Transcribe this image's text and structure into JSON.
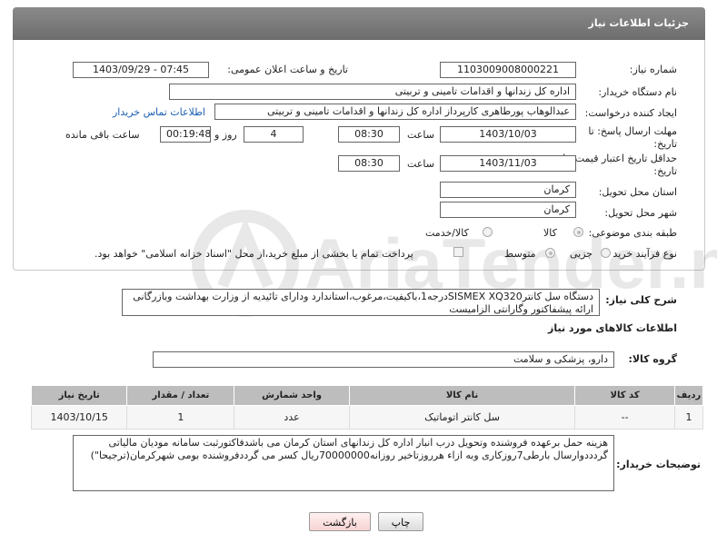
{
  "header": {
    "title": "جزئیات اطلاعات نیاز"
  },
  "form": {
    "need_number_label": "شماره نیاز:",
    "need_number": "1103009008000221",
    "announce_label": "تاریخ و ساعت اعلان عمومی:",
    "announce_value": "1403/09/29 - 07:45",
    "buyer_label": "نام دستگاه خریدار:",
    "buyer_value": "اداره کل زندانها و اقدامات تامینی و تربیتی",
    "creator_label": "ایجاد کننده درخواست:",
    "creator_value": "عبدالوهاب پورطاهری کارپرداز اداره کل زندانها و اقدامات تامینی و تربیتی",
    "contact_link": "اطلاعات تماس خریدار",
    "deadline_label_line1": "مهلت ارسال پاسخ: تا",
    "deadline_label_line2": "تاریخ:",
    "deadline_date": "1403/10/03",
    "time_label": "ساعت",
    "deadline_time": "08:30",
    "days_value": "4",
    "day_and_label": "روز و",
    "remaining_time": "00:19:48",
    "remaining_label": "ساعت باقی مانده",
    "validity_label_line1": "حداقل تاریخ اعتبار قیمت: تا",
    "validity_label_line2": "تاریخ:",
    "validity_date": "1403/11/03",
    "validity_time": "08:30",
    "province_label": "استان محل تحویل:",
    "province_value": "کرمان",
    "city_label": "شهر محل تحویل:",
    "city_value": "کرمان",
    "category_label": "طبقه بندی موضوعی:",
    "category_goods": "کالا",
    "category_goods_service": "کالا/خدمت",
    "purchase_type_label": "نوع فرآیند خرید :",
    "purchase_partial": "جزیی",
    "purchase_medium": "متوسط",
    "payment_note": "پرداخت تمام یا بخشی از مبلغ خرید،از محل \"اسناد خزانه اسلامی\" خواهد بود."
  },
  "description": {
    "label": "شرح کلی نیاز:",
    "text": "دستگاه سل کانترSISMEX XQ320درجه1،باکیفیت،مرغوب،استاندارد ودارای تائیدیه از وزارت بهداشت وبازرگانی ارائه پیشفاکتور وگارانتی الزامیست"
  },
  "goods_info_title": "اطلاعات کالاهای مورد نیاز",
  "goods_group": {
    "label": "گروه کالا:",
    "value": "دارو، پزشکی و سلامت"
  },
  "table": {
    "headers": [
      "ردیف",
      "کد کالا",
      "نام کالا",
      "واحد شمارش",
      "تعداد / مقدار",
      "تاریخ نیاز"
    ],
    "rows": [
      [
        "1",
        "--",
        "سل کانتر اتوماتیک",
        "عدد",
        "1",
        "1403/10/15"
      ]
    ]
  },
  "buyer_notes": {
    "label": "توضیحات خریدار:",
    "text": "هزینه حمل برعهده فروشنده وتحویل درب انبار اداره کل زندانهای استان کرمان می باشدفاکتورثبت سامانه مودیان مالیاتی گردددوارسال بارطی7روزکاری وبه ازاء هرروزتاخیر روزانه70000000ریال کسر می گرددفروشنده بومی شهرکرمان(ترجیحا\")"
  },
  "buttons": {
    "print": "چاپ",
    "back": "بازگشت"
  },
  "watermark": "AriaTender.neT",
  "colors": {
    "header": "#777777",
    "link": "#1a5fb4",
    "table_header": "#bdbdbd",
    "back_button_bg": "#fde2e2"
  }
}
